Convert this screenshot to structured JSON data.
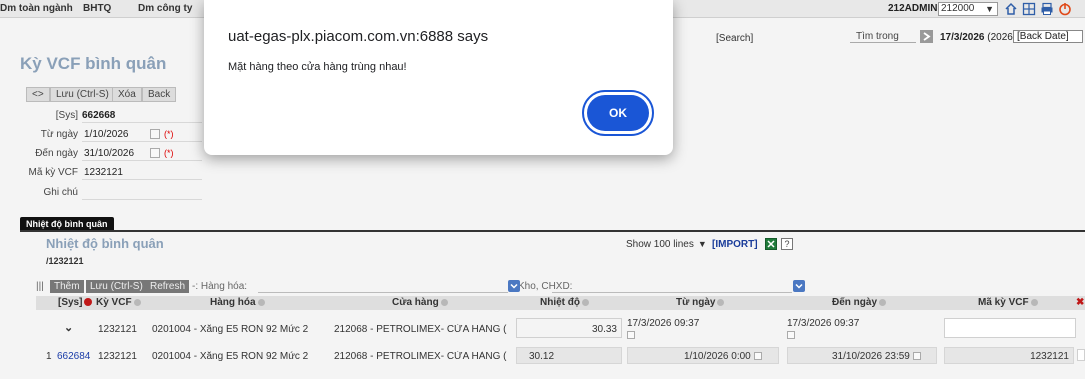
{
  "topbar": {
    "menu": [
      "Dm toàn ngành",
      "BHTQ",
      "Dm công ty"
    ],
    "user": "212ADMIN",
    "company": "212000"
  },
  "subbar": {
    "search": "[Search]",
    "search_in": "Tìm trong",
    "work_date": "17/3/2026",
    "work_year": "(2026)",
    "back_date": "[Back Date]"
  },
  "page": {
    "title": "Kỳ VCF bình quân"
  },
  "toolbar": {
    "nav": "<>",
    "save": "Lưu (Ctrl-S)",
    "delete": "Xóa",
    "back": "Back"
  },
  "form": {
    "sys_label": "[Sys]",
    "sys_value": "662668",
    "from_label": "Từ ngày",
    "from_value": "1/10/2026",
    "to_label": "Đến ngày",
    "to_value": "31/10/2026",
    "required_mark": "(*)",
    "code_label": "Mã kỳ VCF",
    "code_value": "1232121",
    "note_label": "Ghi chú"
  },
  "section": {
    "tab": "Nhiệt độ bình quân",
    "title": "Nhiệt độ bình quân",
    "code": "/1232121",
    "show_lines": "Show 100 lines",
    "import": "[IMPORT]",
    "help": "?"
  },
  "grid_toolbar": {
    "handle": "|||",
    "add": "Thêm",
    "save": "Lưu (Ctrl-S)",
    "refresh": "Refresh",
    "filter_goods": "-: Hàng hóa:",
    "filter_store": "Kho, CHXD:"
  },
  "grid": {
    "columns": [
      "[Sys]",
      "Kỳ VCF",
      "Hàng hóa",
      "Cửa hàng",
      "Nhiệt độ",
      "Từ ngày",
      "Đến ngày",
      "Mã kỳ VCF"
    ],
    "edit_row": {
      "toggle": "⌄",
      "period": "1232121",
      "goods": "0201004 - Xăng E5 RON 92 Mức 2",
      "store": "212068 - PETROLIMEX- CỬA HÀNG (",
      "temperature": "30.33",
      "from": "17/3/2026 09:37",
      "to": "17/3/2026 09:37"
    },
    "data_row": {
      "index": "1",
      "sys": "662684",
      "period": "1232121",
      "goods": "0201004 - Xăng E5 RON 92 Mức 2",
      "store": "212068 - PETROLIMEX- CỬA HÀNG (",
      "temperature": "30.12",
      "from": "1/10/2026 0:00",
      "to": "31/10/2026 23:59",
      "code": "1232121"
    }
  },
  "dialog": {
    "title": "uat-egas-plx.piacom.com.vn:6888 says",
    "message": "Mặt hàng theo cửa hàng trùng nhau!",
    "ok": "OK"
  },
  "colors": {
    "title": "#8aa0b8",
    "dialog_button": "#1a56d6",
    "link": "#1a3ca8",
    "required": "#dd0000"
  }
}
